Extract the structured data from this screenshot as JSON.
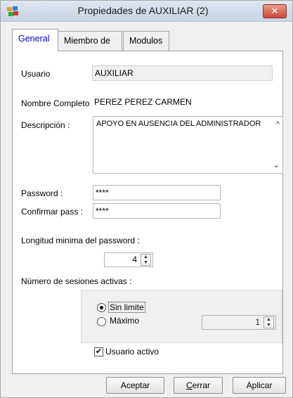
{
  "window": {
    "title": "Propiedades de AUXILIAR (2)",
    "close_label": "✕",
    "app_icon": "users-icon"
  },
  "tabs": [
    {
      "label": "General",
      "active": true
    },
    {
      "label": "Miembro de",
      "active": false
    },
    {
      "label": "Modulos",
      "active": false
    }
  ],
  "general": {
    "usuario_label": "Usuario",
    "usuario_value": "AUXILIAR",
    "nombre_label": "Nombre Completo",
    "nombre_value": "PEREZ PEREZ CARMEN",
    "descripcion_label": "Descripción :",
    "descripcion_value": "APOYO EN AUSENCIA DEL ADMINISTRADOR",
    "password_label": "Password :",
    "password_value": "****",
    "confirmar_label": "Confirmar pass :",
    "confirmar_value": "****",
    "longitud_label": "Longitud minima del password :",
    "longitud_value": "4",
    "sesiones_label": "Número de sesiones activas :",
    "sin_limite_label": "Sin limite",
    "sin_limite_checked": true,
    "maximo_label": "Máximo",
    "maximo_value": "1",
    "usuario_activo_label": "Usuario activo",
    "usuario_activo_checked": true
  },
  "buttons": {
    "aceptar": "Aceptar",
    "cerrar": "Cerrar",
    "aplicar": "Aplicar"
  },
  "colors": {
    "active_tab_text": "#0000d8",
    "close_button": "#c94a36"
  }
}
